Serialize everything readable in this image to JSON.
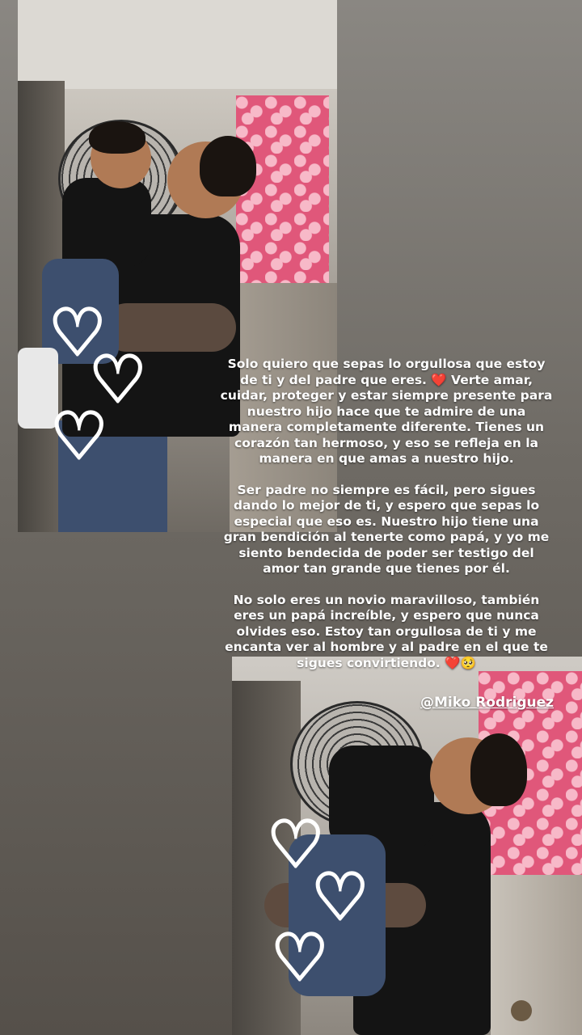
{
  "story": {
    "paragraphs": [
      "Solo quiero que sepas lo orgullosa que estoy de ti y del padre que eres. ❤️  Verte amar, cuidar, proteger y estar siempre presente para nuestro hijo hace que te admire de una manera completamente diferente. Tienes un corazón tan hermoso, y eso se refleja en la manera en que amas a nuestro hijo.",
      "Ser padre no siempre es fácil, pero sigues dando lo mejor de ti, y espero que sepas lo especial que eso es. Nuestro hijo tiene una gran bendición al tenerte como papá, y yo me siento bendecida de poder ser testigo del amor tan grande que tienes por él.",
      "No solo eres un novio maravilloso, también eres un papá increíble, y espero que nunca olvides eso. Estoy tan orgullosa de ti y me encanta ver al hombre y al padre en el que te sigues convirtiendo. ❤️🥺"
    ],
    "mention": "@Miko Rodriguez"
  },
  "stickers": {
    "heart_glyph": "♡",
    "heart_color": "#ffffff"
  },
  "colors": {
    "background": "#6e6a64",
    "text": "#ffffff",
    "blanket": "#e0577a"
  }
}
